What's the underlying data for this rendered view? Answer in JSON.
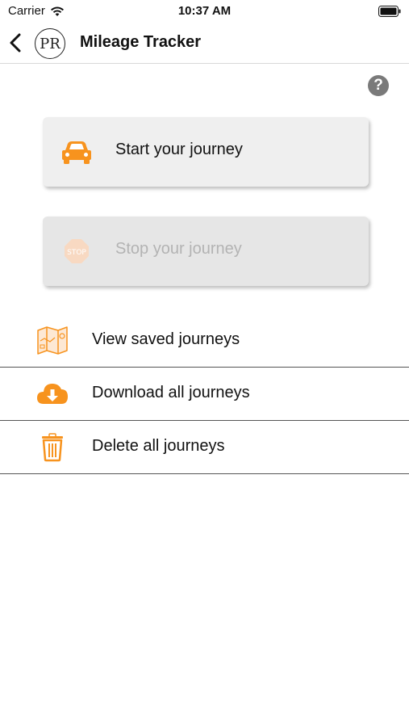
{
  "status_bar": {
    "carrier": "Carrier",
    "time": "10:37 AM"
  },
  "nav": {
    "logo_text": "PR",
    "title": "Mileage Tracker"
  },
  "help": {
    "label": "?"
  },
  "actions": [
    {
      "label": "Start your journey",
      "icon": "car-icon",
      "enabled": true
    },
    {
      "label": "Stop your journey",
      "icon": "stop-sign-icon",
      "enabled": false
    }
  ],
  "list": [
    {
      "label": "View saved journeys",
      "icon": "map-icon"
    },
    {
      "label": "Download all journeys",
      "icon": "cloud-download-icon"
    },
    {
      "label": "Delete all journeys",
      "icon": "trash-icon"
    }
  ],
  "colors": {
    "accent": "#f7931e",
    "card_bg": "#efefef",
    "disabled_text": "#b3b3b3"
  }
}
